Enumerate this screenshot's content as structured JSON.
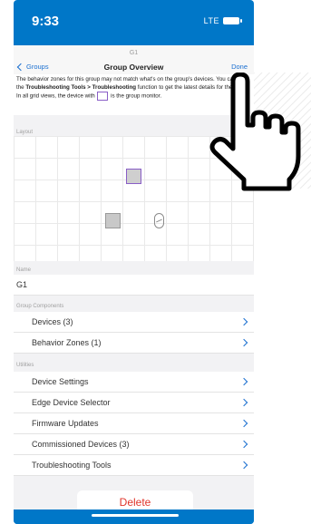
{
  "status": {
    "time": "9:33",
    "network": "LTE"
  },
  "nav": {
    "subtitle": "G1",
    "title": "Group Overview",
    "back_label": "Groups",
    "done_label": "Done"
  },
  "notice": {
    "part1": "The behavior zones for this group may not match what's on the group's devices. You can use the ",
    "bold": "Troubleshooting Tools > Troubleshooting",
    "part2": " function to get the latest details for the group.",
    "line2a": "In all grid views, the device with ",
    "line2b": " is the group monitor."
  },
  "sections": {
    "layout": "Layout",
    "name": "Name",
    "components": "Group Components",
    "utilities": "Utilities"
  },
  "name_value": "G1",
  "components": [
    {
      "label": "Devices (3)"
    },
    {
      "label": "Behavior Zones (1)"
    }
  ],
  "utilities": [
    {
      "label": "Device Settings"
    },
    {
      "label": "Edge Device Selector"
    },
    {
      "label": "Firmware Updates"
    },
    {
      "label": "Commissioned Devices (3)"
    },
    {
      "label": "Troubleshooting Tools"
    }
  ],
  "delete_label": "Delete",
  "colors": {
    "accent": "#1a6fd0",
    "frame": "#0077c8",
    "monitor": "#8a5ec7",
    "delete": "#e0352b"
  }
}
